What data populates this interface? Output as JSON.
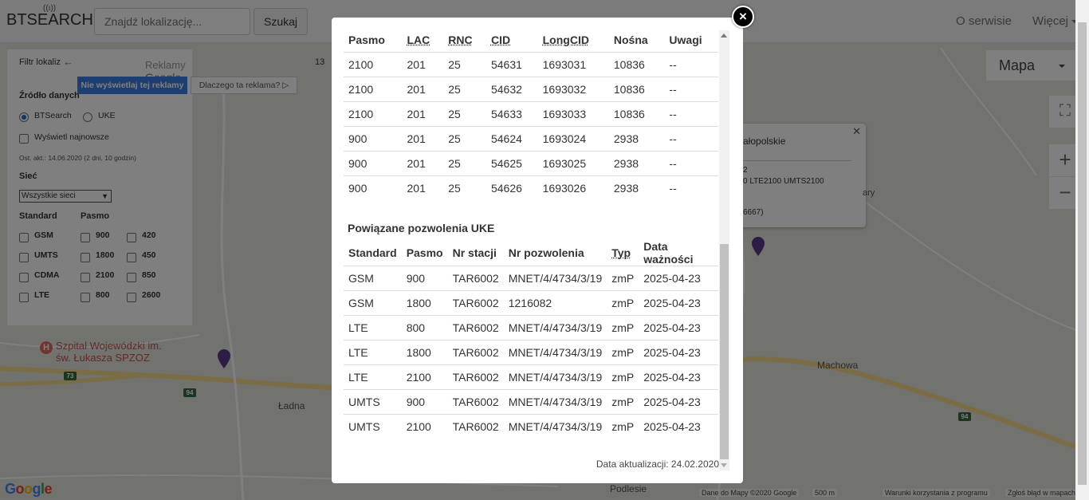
{
  "app": {
    "logo": "BTSEARCH",
    "search_placeholder": "Znajdź lokalizację...",
    "search_button": "Szukaj",
    "nav_about": "O serwisie",
    "nav_more": "Więcej"
  },
  "filter": {
    "header": "Filtr lokaliz",
    "ads_label": "Reklamy",
    "ads_brand": "Google",
    "ad_hide": "Nie wyświetlaj tej reklamy",
    "ad_why": "Dlaczego ta reklama? ▷",
    "ad_number": "13",
    "source_label": "Źródło danych",
    "source_btsearch": "BTSearch",
    "source_uke": "UKE",
    "show_newest": "Wyświetl najnowsze",
    "last_update": "Ost. akt.: 14.06.2020 (2 dni, 10 godzin)",
    "network_label": "Sieć",
    "network_selected": "Wszystkie sieci",
    "standard_label": "Standard",
    "band_label": "Pasmo",
    "standards": [
      "GSM",
      "UMTS",
      "CDMA",
      "LTE"
    ],
    "bands_col1": [
      "900",
      "1800",
      "2100",
      "800"
    ],
    "bands_col2": [
      "420",
      "450",
      "850",
      "2600"
    ]
  },
  "map": {
    "hospital": "Szpital Wojewódzki im.",
    "hospital_2": "św. Łukasza SPZOZ",
    "place_ladna": "Ładna",
    "place_machowa": "Machowa",
    "place_podlesie": "Podlesie",
    "route_73": "73",
    "route_94": "94",
    "map_type": "Mapa",
    "google": "Google",
    "footer_data": "Dane do Mapy ©2020 Google",
    "footer_scale": "500 m",
    "footer_terms": "Warunki korzystania z programu",
    "footer_report": "Zgłoś błąd w mapach"
  },
  "infowindow": {
    "title": "ałopolskie",
    "line1": "2",
    "line2": "0 LTE2100 UMTS2100",
    "line3": "6667)",
    "side_text": "ary"
  },
  "modal": {
    "cells_headers": [
      "Pasmo",
      "LAC",
      "RNC",
      "CID",
      "LongCID",
      "Nośna",
      "Uwagi"
    ],
    "cells_rows": [
      [
        "2100",
        "201",
        "25",
        "54631",
        "1693031",
        "10836",
        "--"
      ],
      [
        "2100",
        "201",
        "25",
        "54632",
        "1693032",
        "10836",
        "--"
      ],
      [
        "2100",
        "201",
        "25",
        "54633",
        "1693033",
        "10836",
        "--"
      ],
      [
        "900",
        "201",
        "25",
        "54624",
        "1693024",
        "2938",
        "--"
      ],
      [
        "900",
        "201",
        "25",
        "54625",
        "1693025",
        "2938",
        "--"
      ],
      [
        "900",
        "201",
        "25",
        "54626",
        "1693026",
        "2938",
        "--"
      ]
    ],
    "permits_title": "Powiązane pozwolenia UKE",
    "permits_headers": [
      "Standard",
      "Pasmo",
      "Nr stacji",
      "Nr pozwolenia",
      "Typ",
      "Data ważności"
    ],
    "permits_rows": [
      [
        "GSM",
        "900",
        "TAR6002",
        "MNET/4/4734/3/19",
        "zmP",
        "2025-04-23"
      ],
      [
        "GSM",
        "1800",
        "TAR6002",
        "1216082",
        "zmP",
        "2025-04-23"
      ],
      [
        "LTE",
        "800",
        "TAR6002",
        "MNET/4/4734/3/19",
        "zmP",
        "2025-04-23"
      ],
      [
        "LTE",
        "1800",
        "TAR6002",
        "MNET/4/4734/3/19",
        "zmP",
        "2025-04-23"
      ],
      [
        "LTE",
        "2100",
        "TAR6002",
        "MNET/4/4734/3/19",
        "zmP",
        "2025-04-23"
      ],
      [
        "UMTS",
        "900",
        "TAR6002",
        "MNET/4/4734/3/19",
        "zmP",
        "2025-04-23"
      ],
      [
        "UMTS",
        "2100",
        "TAR6002",
        "MNET/4/4734/3/19",
        "zmP",
        "2025-04-23"
      ]
    ],
    "updated": "Data aktualizacji: 24.02.2020"
  },
  "colors": {
    "accent": "#1a6ed8",
    "pin": "#5b3a8c",
    "ad_button": "#3a7de0"
  }
}
